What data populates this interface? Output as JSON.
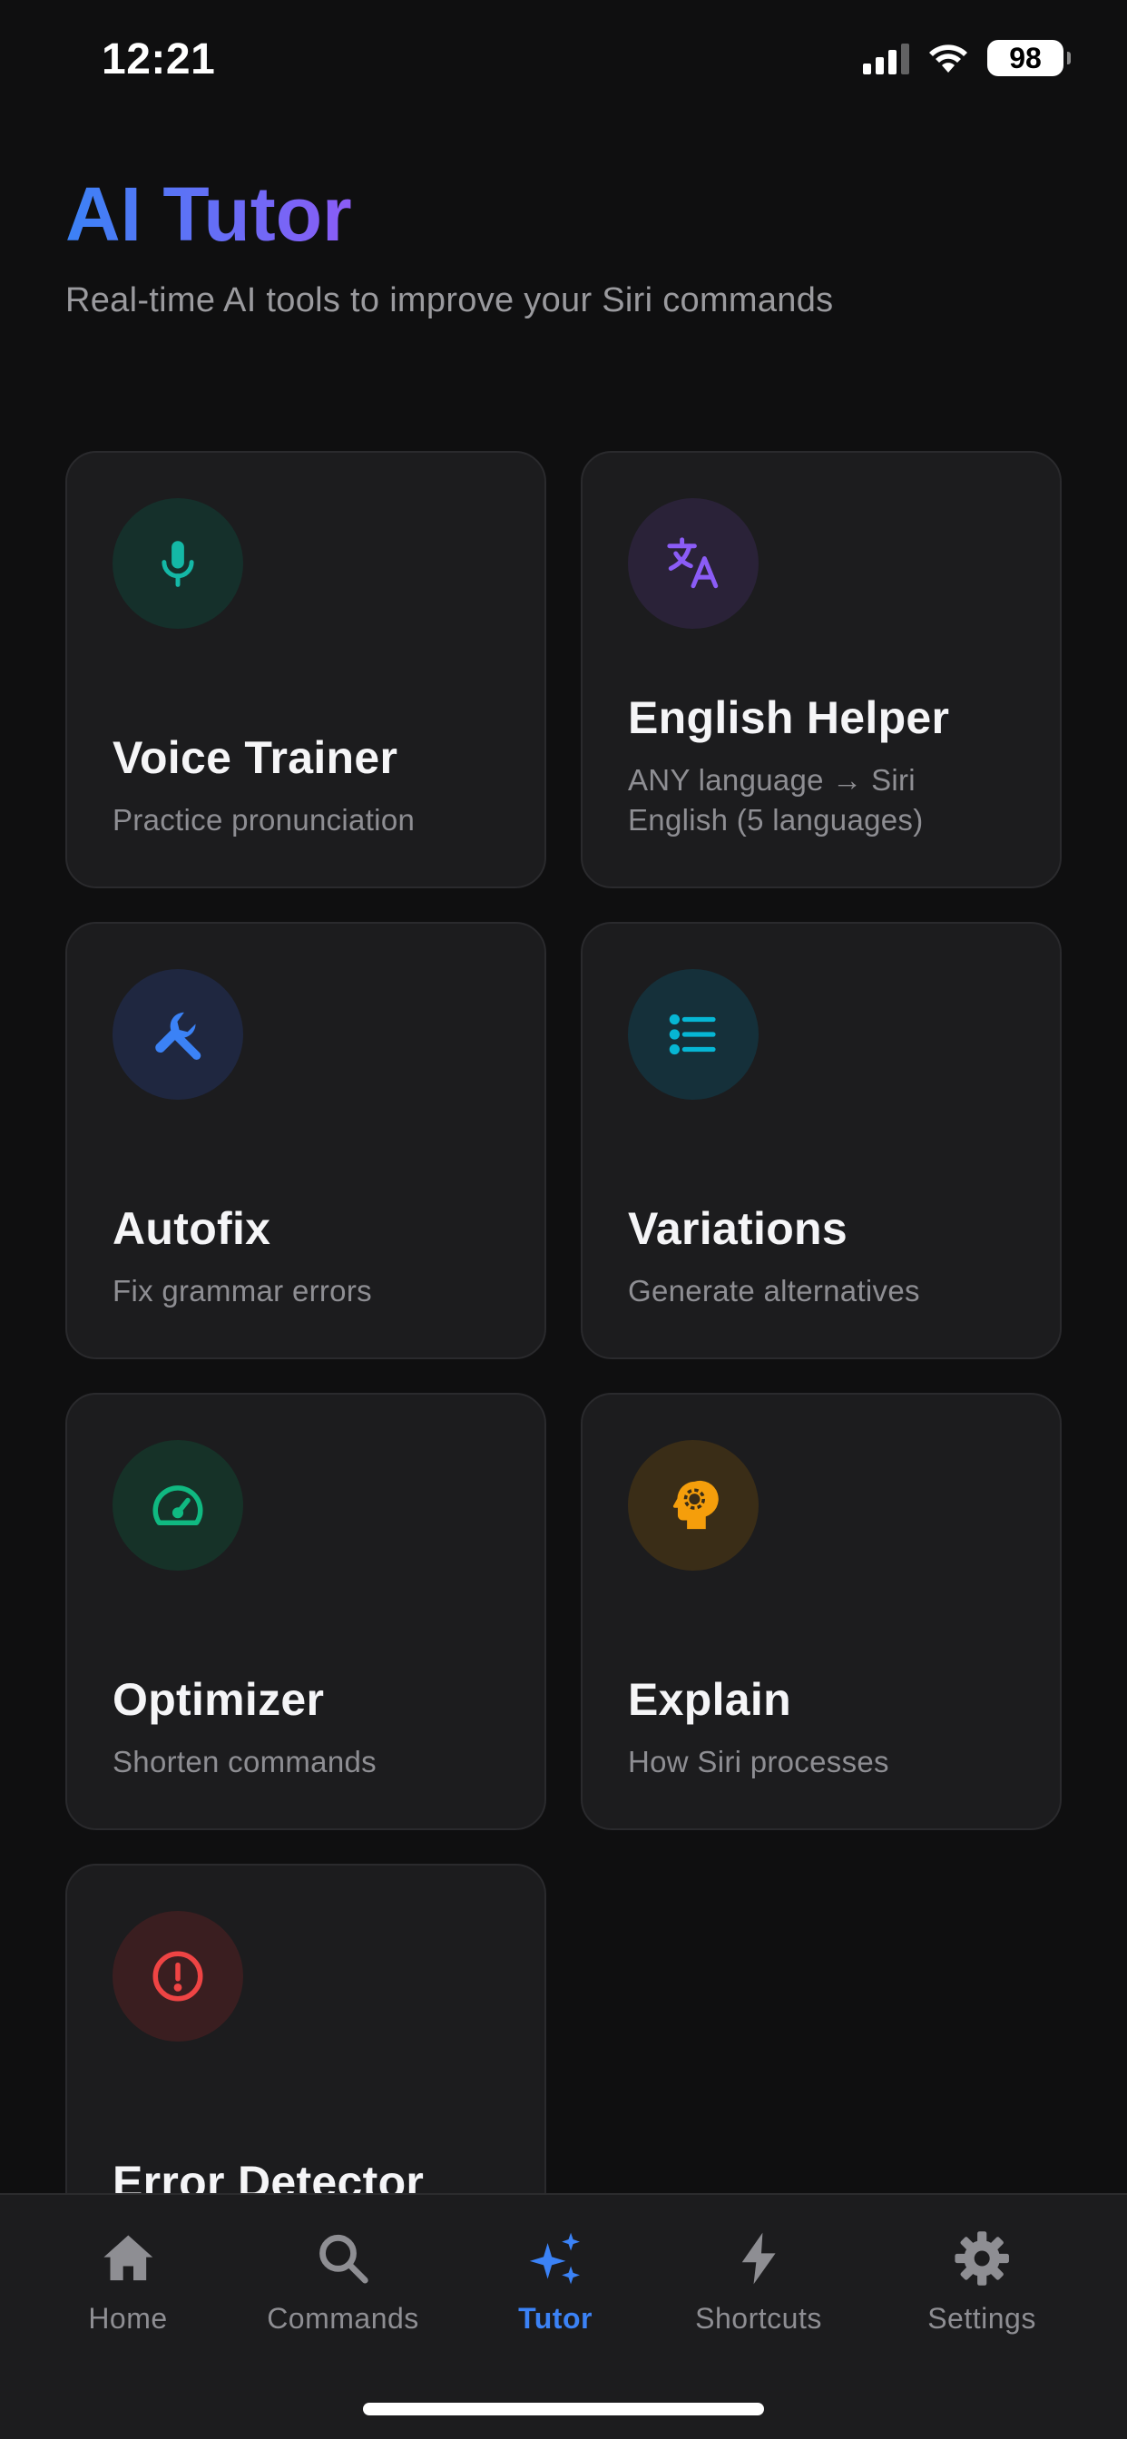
{
  "status_bar": {
    "time": "12:21",
    "battery": "98"
  },
  "header": {
    "title": "AI Tutor",
    "subtitle": "Real-time AI tools to improve your Siri commands"
  },
  "tools": [
    {
      "title": "Voice Trainer",
      "description": "Practice pronunciation",
      "icon": "microphone-icon",
      "color": "#14b8a6",
      "bg": "#15302b"
    },
    {
      "title": "English Helper",
      "description": "ANY language → Siri English (5 languages)",
      "icon": "translate-icon",
      "color": "#8b5cf6",
      "bg": "#2a2238"
    },
    {
      "title": "Autofix",
      "description": "Fix grammar errors",
      "icon": "wrench-icon",
      "color": "#3b82f6",
      "bg": "#1f2740"
    },
    {
      "title": "Variations",
      "description": "Generate alternatives",
      "icon": "list-icon",
      "color": "#06b6d4",
      "bg": "#15303a"
    },
    {
      "title": "Optimizer",
      "description": "Shorten commands",
      "icon": "speedometer-icon",
      "color": "#10b981",
      "bg": "#163228"
    },
    {
      "title": "Explain",
      "description": "How Siri processes",
      "icon": "brain-gear-icon",
      "color": "#f59e0b",
      "bg": "#3a2d17"
    },
    {
      "title": "Error Detector",
      "description": "",
      "icon": "alert-circle-icon",
      "color": "#ef4444",
      "bg": "#3a1e20"
    }
  ],
  "tab_bar": {
    "tabs": [
      {
        "label": "Home",
        "icon": "home-icon",
        "active": false
      },
      {
        "label": "Commands",
        "icon": "search-icon",
        "active": false
      },
      {
        "label": "Tutor",
        "icon": "sparkles-icon",
        "active": true
      },
      {
        "label": "Shortcuts",
        "icon": "bolt-icon",
        "active": false
      },
      {
        "label": "Settings",
        "icon": "gear-icon",
        "active": false
      }
    ]
  },
  "colors": {
    "accent": "#3b82f6",
    "title_gradient_start": "#3b82f6",
    "title_gradient_end": "#8b5cf6",
    "background": "#0f0f10",
    "card": "#1c1c1e"
  }
}
